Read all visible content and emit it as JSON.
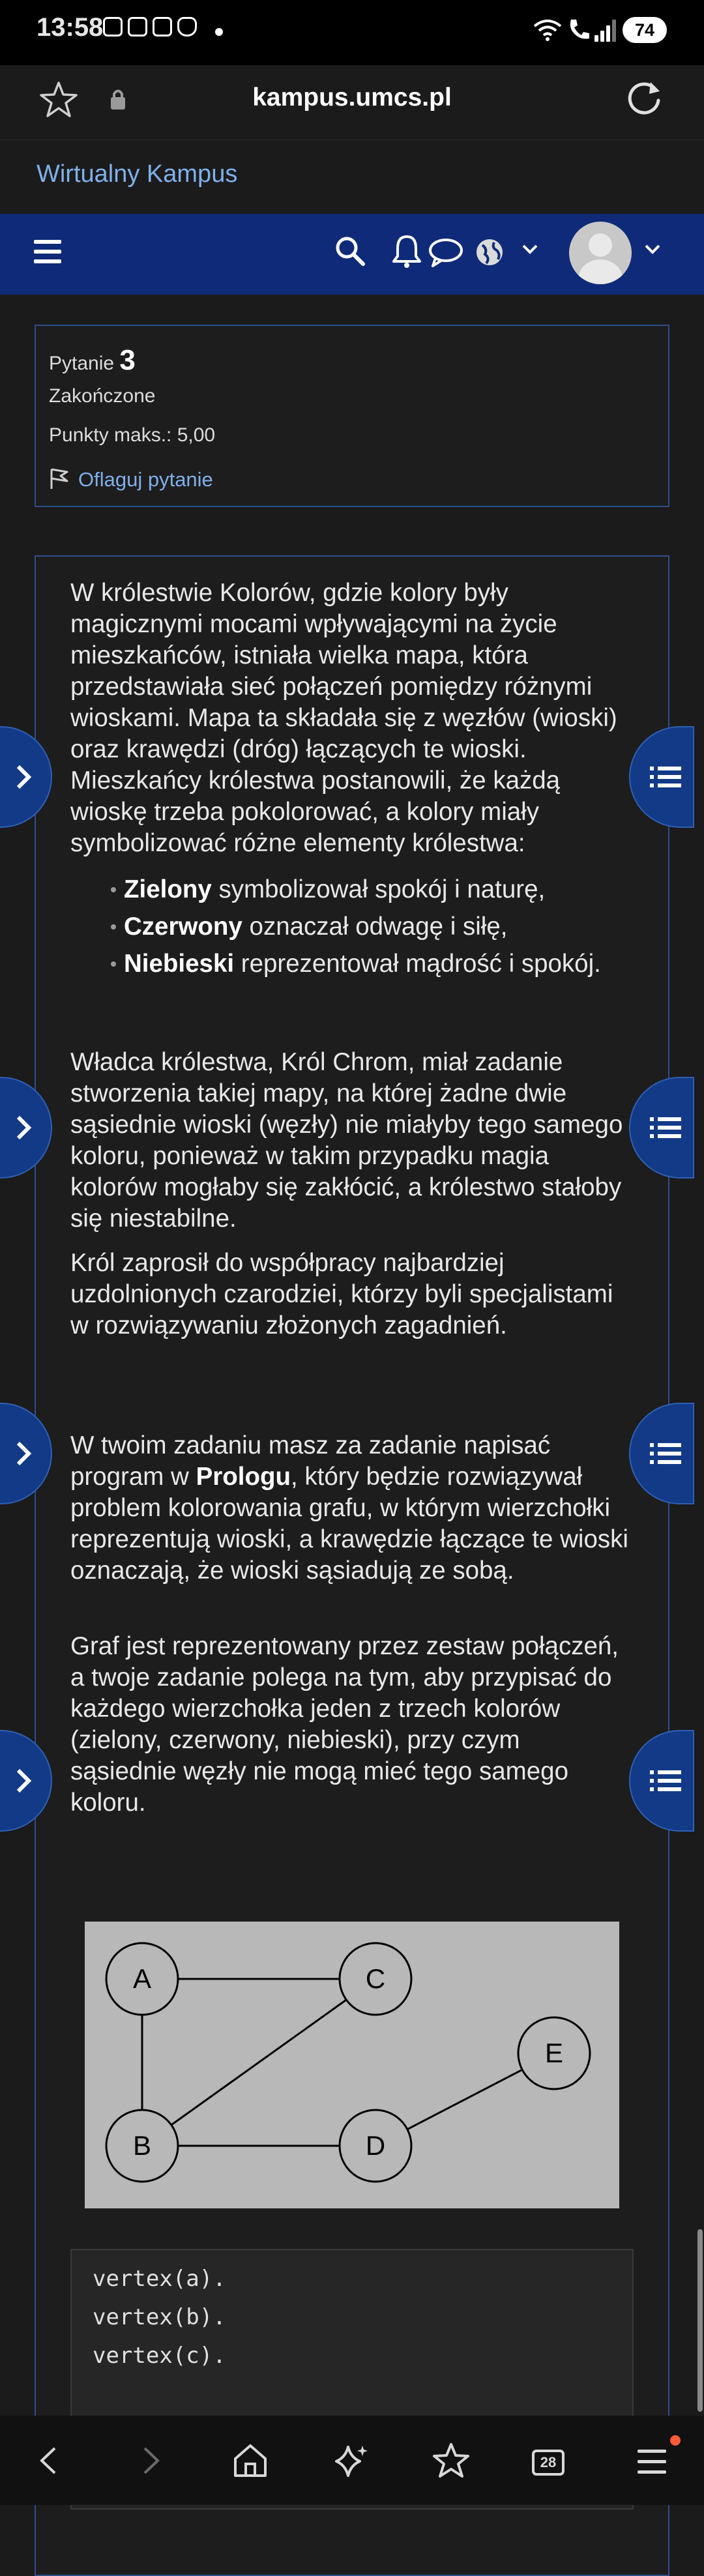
{
  "status_bar": {
    "time": "13:58",
    "battery": "74"
  },
  "browser": {
    "url": "kampus.umcs.pl"
  },
  "site": {
    "title": "Wirtualny Kampus"
  },
  "question_info": {
    "label": "Pytanie",
    "number": "3",
    "state": "Zakończone",
    "points": "Punkty maks.: 5,00",
    "flag_link": "Oflaguj pytanie"
  },
  "content": {
    "p1": "W królestwie Kolorów, gdzie kolory były magicznymi mocami wpływającymi na życie mieszkańców, istniała wielka mapa, która przedstawiała sieć połączeń pomiędzy różnymi wioskami. Mapa ta składała się z węzłów (wioski) oraz krawędzi (dróg) łączących te wioski. Mieszkańcy królestwa postanowili, że każdą wioskę trzeba pokolorować, a kolory miały symbolizować różne elementy królestwa:",
    "bullets": [
      {
        "bold": "Zielony",
        "rest": " symbolizował spokój i naturę,"
      },
      {
        "bold": "Czerwony",
        "rest": " oznaczał odwagę i siłę,"
      },
      {
        "bold": "Niebieski",
        "rest": " reprezentował mądrość i spokój."
      }
    ],
    "p2": "Władca królestwa, Król Chrom, miał zadanie stworzenia takiej mapy, na której żadne dwie sąsiednie wioski (węzły) nie miałyby tego samego koloru, ponieważ w takim przypadku magia kolorów mogłaby się zakłócić, a królestwo stałoby się niestabilne.",
    "p3": "Król zaprosił do współpracy najbardziej uzdolnionych czarodziei, którzy byli specjalistami w rozwiązywaniu złożonych zagadnień.",
    "p4_a": "W twoim zadaniu masz za zadanie napisać program w ",
    "p4_bold": "Prologu",
    "p4_b": ", który będzie rozwiązywał problem kolorowania grafu, w którym wierzchołki reprezentują wioski, a krawędzie łączące te wioski oznaczają, że wioski sąsiadują ze sobą.",
    "p5": "Graf jest reprezentowany przez zestaw połączeń, a twoje zadanie polega na tym, aby przypisać do każdego wierzchołka jeden z trzech kolorów (zielony, czerwony, niebieski), przy czym sąsiednie węzły nie mogą mieć tego samego koloru."
  },
  "graph": {
    "nodes": [
      "A",
      "B",
      "C",
      "D",
      "E"
    ],
    "edges": [
      [
        "A",
        "B"
      ],
      [
        "A",
        "C"
      ],
      [
        "B",
        "C"
      ],
      [
        "B",
        "D"
      ],
      [
        "D",
        "E"
      ]
    ]
  },
  "code": [
    "vertex(a).",
    "vertex(b).",
    "vertex(c)."
  ],
  "bottom_nav": {
    "tabs_count": "28"
  },
  "colors": {
    "navbar": "#0f2a78",
    "link": "#7fb0ea",
    "border": "#2d4f8c"
  }
}
